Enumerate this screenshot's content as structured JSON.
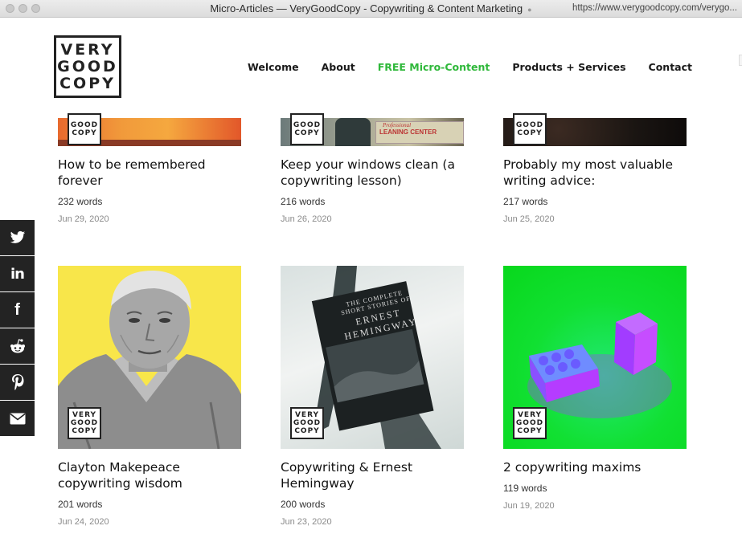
{
  "browser": {
    "window_title": "Micro-Articles — VeryGoodCopy - Copywriting & Content Marketing",
    "url": "https://www.verygoodcopy.com/verygo..."
  },
  "logo": {
    "line1": "VERY",
    "line2": "GOOD",
    "line3": "COPY"
  },
  "nav": [
    {
      "label": "Welcome",
      "active": false
    },
    {
      "label": "About",
      "active": false
    },
    {
      "label": "FREE Micro-Content",
      "active": true
    },
    {
      "label": "Products + Services",
      "active": false
    },
    {
      "label": "Contact",
      "active": false
    }
  ],
  "colors": {
    "accent": "#2fb83a",
    "dark": "#232323"
  },
  "articles": [
    {
      "title": "How to be remembered forever",
      "words": "232 words",
      "date": "Jun 29, 2020"
    },
    {
      "title": "Keep your windows clean (a copywriting lesson)",
      "words": "216 words",
      "date": "Jun 26, 2020",
      "sign_text": "Professional",
      "sign_text2": "LEANING CENTER"
    },
    {
      "title": "Probably my most valuable writing advice:",
      "words": "217 words",
      "date": "Jun 25, 2020"
    },
    {
      "title": "Clayton Makepeace copywriting wisdom",
      "words": "201 words",
      "date": "Jun 24, 2020"
    },
    {
      "title": "Copywriting & Ernest Hemingway",
      "words": "200 words",
      "date": "Jun 23, 2020",
      "book_line1": "THE COMPLETE",
      "book_line2": "SHORT STORIES OF",
      "book_line3": "ERNEST",
      "book_line4": "HEMINGWAY"
    },
    {
      "title": "2 copywriting maxims",
      "words": "119 words",
      "date": "Jun 19, 2020"
    }
  ],
  "social": [
    {
      "icon": "twitter-icon",
      "glyph": "🐦"
    },
    {
      "icon": "linkedin-icon",
      "glyph": "in"
    },
    {
      "icon": "facebook-icon",
      "glyph": "f"
    },
    {
      "icon": "reddit-icon",
      "glyph": "◉"
    },
    {
      "icon": "pinterest-icon",
      "glyph": "P"
    },
    {
      "icon": "email-icon",
      "glyph": "✉"
    }
  ]
}
